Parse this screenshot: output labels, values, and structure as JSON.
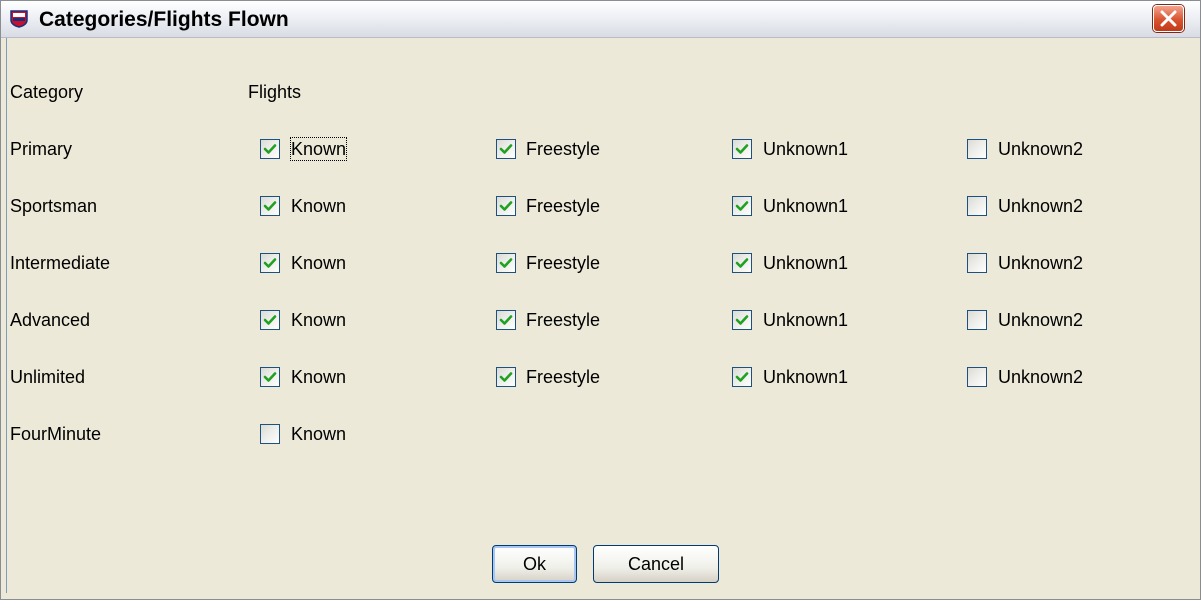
{
  "window": {
    "title": "Categories/Flights Flown"
  },
  "headers": {
    "category": "Category",
    "flights": "Flights"
  },
  "rows": [
    {
      "category": "Primary",
      "flights": [
        {
          "label": "Known",
          "checked": true
        },
        {
          "label": "Freestyle",
          "checked": true
        },
        {
          "label": "Unknown1",
          "checked": true
        },
        {
          "label": "Unknown2",
          "checked": false
        }
      ]
    },
    {
      "category": "Sportsman",
      "flights": [
        {
          "label": "Known",
          "checked": true
        },
        {
          "label": "Freestyle",
          "checked": true
        },
        {
          "label": "Unknown1",
          "checked": true
        },
        {
          "label": "Unknown2",
          "checked": false
        }
      ]
    },
    {
      "category": "Intermediate",
      "flights": [
        {
          "label": "Known",
          "checked": true
        },
        {
          "label": "Freestyle",
          "checked": true
        },
        {
          "label": "Unknown1",
          "checked": true
        },
        {
          "label": "Unknown2",
          "checked": false
        }
      ]
    },
    {
      "category": "Advanced",
      "flights": [
        {
          "label": "Known",
          "checked": true
        },
        {
          "label": "Freestyle",
          "checked": true
        },
        {
          "label": "Unknown1",
          "checked": true
        },
        {
          "label": "Unknown2",
          "checked": false
        }
      ]
    },
    {
      "category": "Unlimited",
      "flights": [
        {
          "label": "Known",
          "checked": true
        },
        {
          "label": "Freestyle",
          "checked": true
        },
        {
          "label": "Unknown1",
          "checked": true
        },
        {
          "label": "Unknown2",
          "checked": false
        }
      ]
    },
    {
      "category": "FourMinute",
      "flights": [
        {
          "label": "Known",
          "checked": false
        }
      ]
    }
  ],
  "buttons": {
    "ok": "Ok",
    "cancel": "Cancel"
  },
  "colors": {
    "check": "#21a121",
    "close_button": "#d9532f",
    "checkbox_border": "#1c5180"
  }
}
